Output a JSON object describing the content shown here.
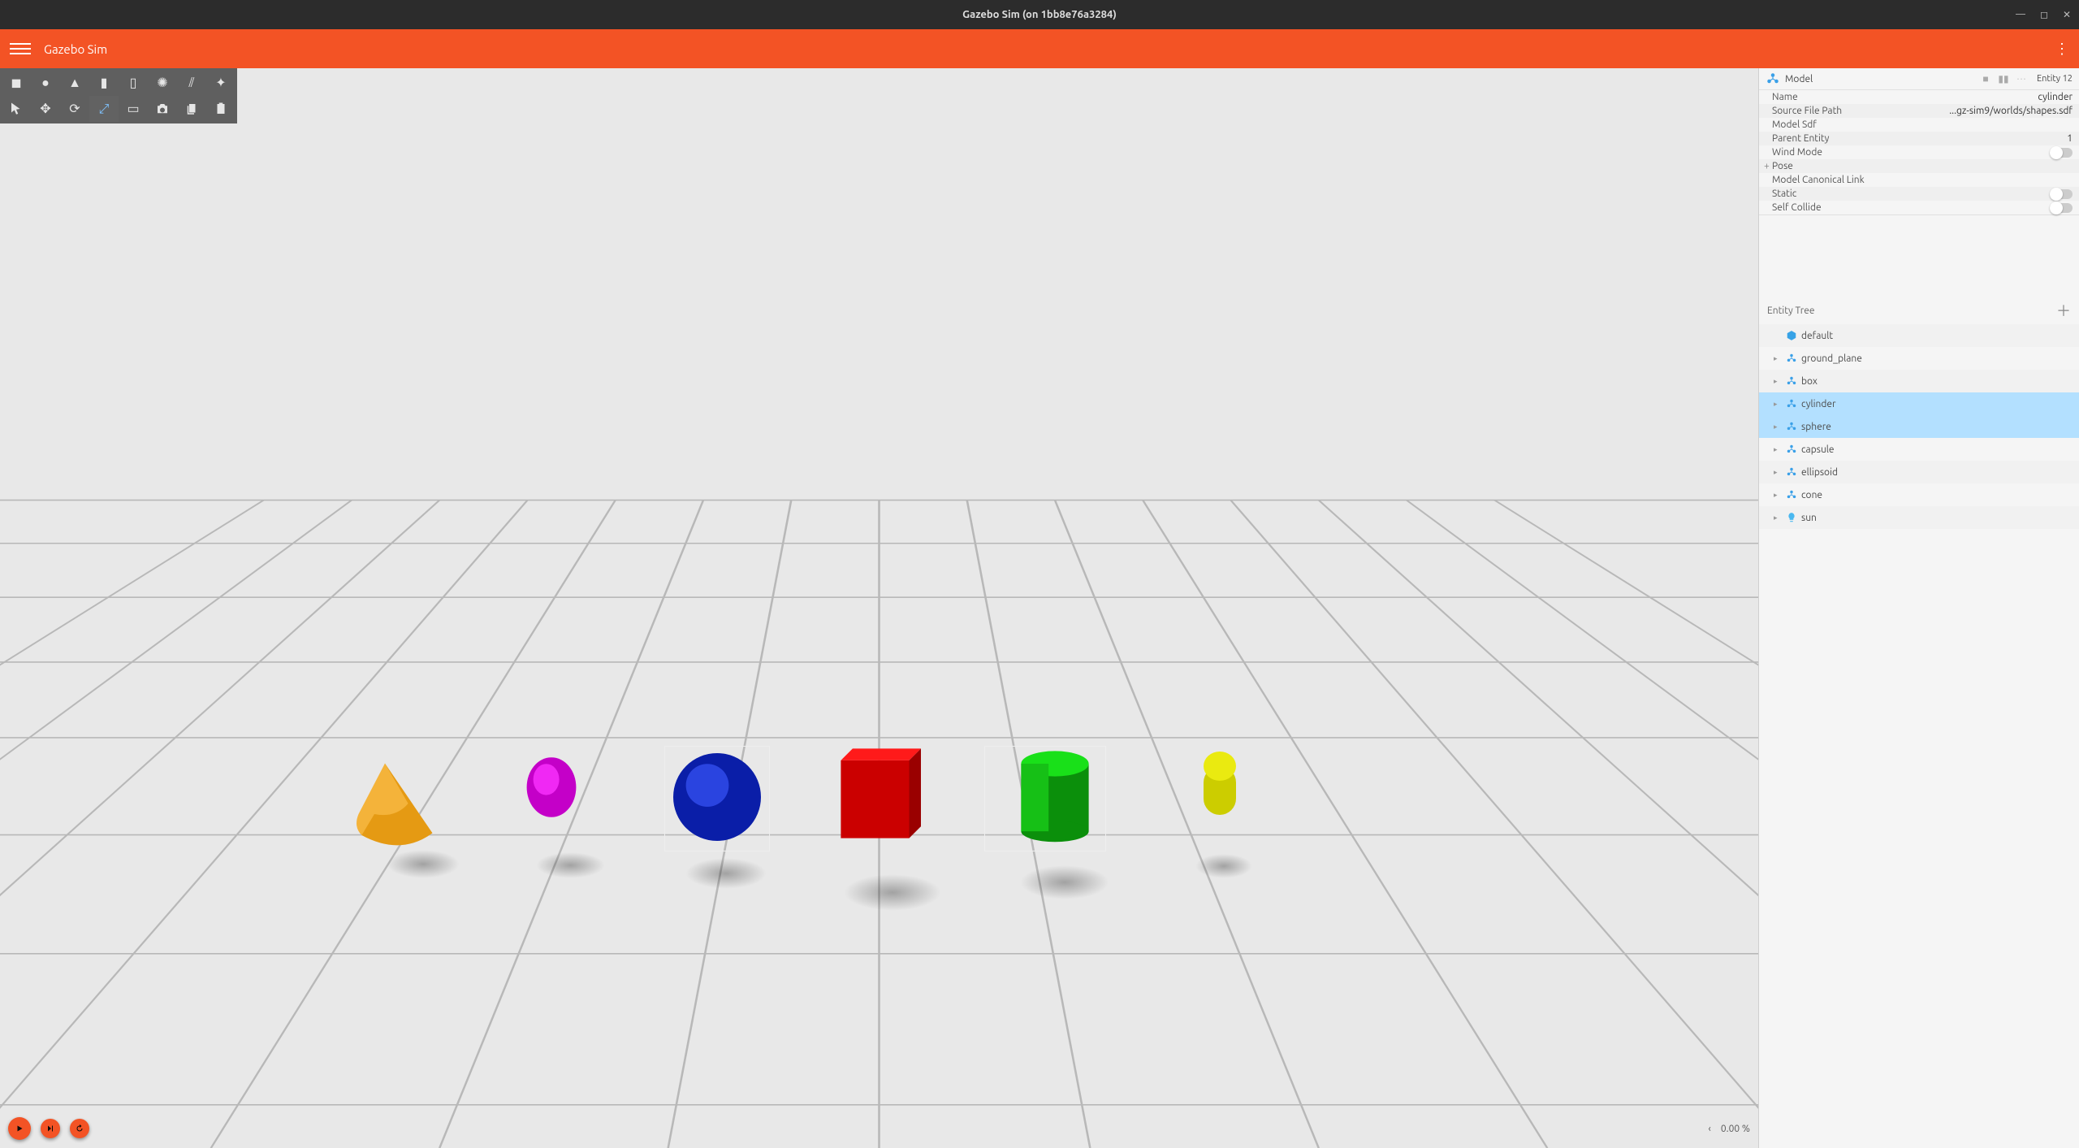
{
  "os_title": "Gazebo Sim (on 1bb8e76a3284)",
  "app_title": "Gazebo Sim",
  "inspector": {
    "title": "Model",
    "entity_badge": "Entity 12",
    "rows": [
      {
        "k": "Name",
        "v": "cylinder"
      },
      {
        "k": "Source File Path",
        "v": "...gz-sim9/worlds/shapes.sdf"
      },
      {
        "k": "Model Sdf",
        "v": ""
      },
      {
        "k": "Parent Entity",
        "v": "1"
      },
      {
        "k": "Wind Mode",
        "toggle": true
      },
      {
        "k": "Pose",
        "plus": true
      },
      {
        "k": "Model Canonical Link",
        "v": ""
      },
      {
        "k": "Static",
        "toggle": true
      },
      {
        "k": "Self Collide",
        "toggle": true
      }
    ]
  },
  "tree_header": "Entity Tree",
  "tree": [
    {
      "label": "default",
      "icon": "world",
      "exp": false,
      "sel": false
    },
    {
      "label": "ground_plane",
      "icon": "model",
      "exp": true,
      "sel": false
    },
    {
      "label": "box",
      "icon": "model",
      "exp": true,
      "sel": false
    },
    {
      "label": "cylinder",
      "icon": "model",
      "exp": true,
      "sel": true
    },
    {
      "label": "sphere",
      "icon": "model",
      "exp": true,
      "sel": true
    },
    {
      "label": "capsule",
      "icon": "model",
      "exp": true,
      "sel": false
    },
    {
      "label": "ellipsoid",
      "icon": "model",
      "exp": true,
      "sel": false
    },
    {
      "label": "cone",
      "icon": "model",
      "exp": true,
      "sel": false
    },
    {
      "label": "sun",
      "icon": "light",
      "exp": true,
      "sel": false
    }
  ],
  "bottom": {
    "percent": "0.00 %"
  }
}
